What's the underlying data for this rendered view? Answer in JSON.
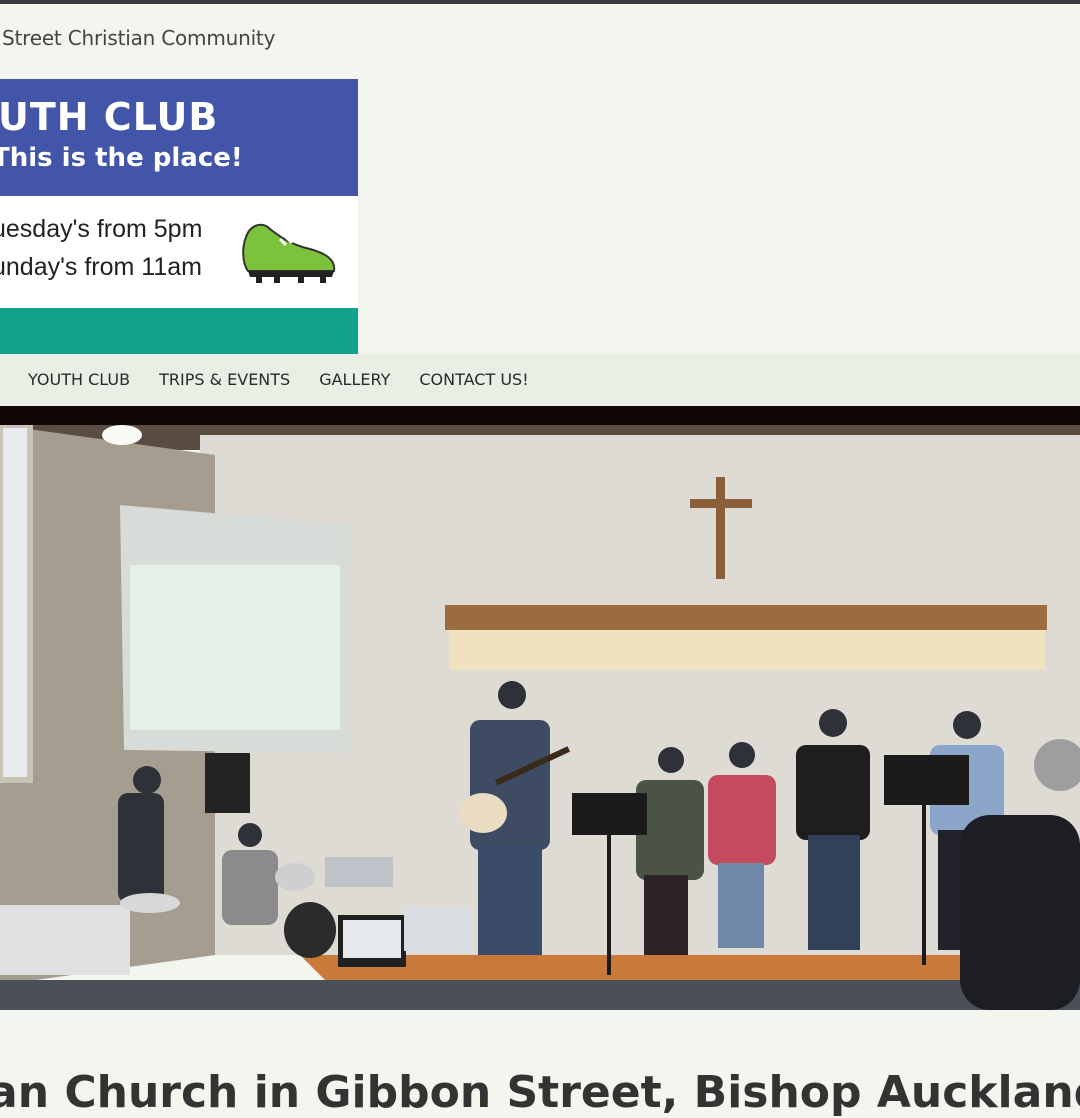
{
  "site": {
    "title": "Street Christian Community"
  },
  "banner": {
    "headline": "UTH CLUB",
    "tagline": "This is the place!",
    "times": [
      "uesday's from 5pm",
      "unday's from 11am"
    ],
    "shoe_icon": "football-boot-icon",
    "colors": {
      "blue": "#4255a8",
      "teal": "#13a38c",
      "boot": "#7cc23a"
    }
  },
  "nav": {
    "items": [
      "YOUTH CLUB",
      "TRIPS & EVENTS",
      "GALLERY",
      "CONTACT US!"
    ]
  },
  "photo": {
    "subject": "worship band performing on stage in church hall"
  },
  "main": {
    "heading": "an Church in Gibbon Street, Bishop Auckland"
  }
}
